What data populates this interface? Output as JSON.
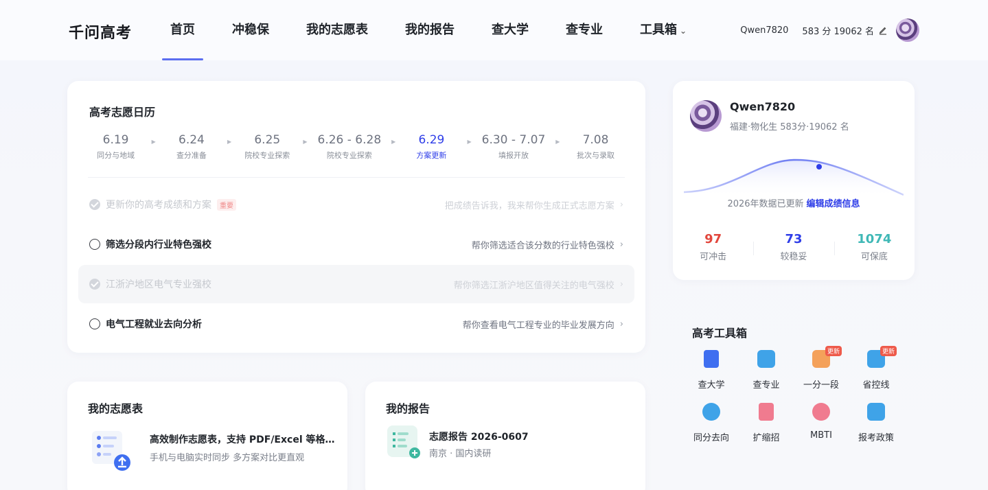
{
  "header": {
    "logo": "千问高考",
    "nav": [
      {
        "label": "首页",
        "active": true
      },
      {
        "label": "冲稳保"
      },
      {
        "label": "我的志愿表"
      },
      {
        "label": "我的报告"
      },
      {
        "label": "查大学"
      },
      {
        "label": "查专业"
      },
      {
        "label": "工具箱"
      }
    ],
    "username": "Qwen7820",
    "score_rank": "583 分 19062 名"
  },
  "calendar": {
    "title": "高考志愿日历",
    "steps": [
      {
        "date": "6.19",
        "label": "同分与地域"
      },
      {
        "date": "6.24",
        "label": "查分准备"
      },
      {
        "date": "6.25",
        "label": "院校专业探索"
      },
      {
        "date": "6.26 - 6.28",
        "label": "院校专业探索"
      },
      {
        "date": "6.29",
        "label": "方案更新",
        "active": true
      },
      {
        "date": "6.30 - 7.07",
        "label": "填报开放"
      },
      {
        "date": "7.08",
        "label": "批次与录取"
      }
    ],
    "tasks": [
      {
        "name": "更新你的高考成绩和方案",
        "badge": "重要",
        "desc": "把成绩告诉我，我来帮你生成正式志愿方案",
        "done": true
      },
      {
        "name": "筛选分段内行业特色强校",
        "desc": "帮你筛选适合该分数的行业特色强校",
        "done": false
      },
      {
        "name": "江浙沪地区电气专业强校",
        "desc": "帮你筛选江浙沪地区值得关注的电气强校",
        "done": true,
        "highlight": true
      },
      {
        "name": "电气工程就业去向分析",
        "desc": "帮你查看电气工程专业的毕业发展方向",
        "done": false
      }
    ]
  },
  "profile": {
    "name": "Qwen7820",
    "info": "福建·物化生 583分·19062 名",
    "update_text": "2026年数据已更新",
    "edit_link": "编辑成绩信息",
    "stats": [
      {
        "value": "97",
        "label": "可冲击",
        "color": "#e2463c"
      },
      {
        "value": "73",
        "label": "较稳妥",
        "color": "#2f3ee8"
      },
      {
        "value": "1074",
        "label": "可保底",
        "color": "#3fb8b6"
      }
    ]
  },
  "toolbox": {
    "title": "高考工具箱",
    "items": [
      {
        "label": "查大学",
        "color": "#3f6ff0",
        "icon": "university-icon"
      },
      {
        "label": "查专业",
        "color": "#3fa3e8",
        "icon": "major-icon"
      },
      {
        "label": "一分一段",
        "color": "#f4a15a",
        "icon": "score-segment-icon",
        "tag": "更新"
      },
      {
        "label": "省控线",
        "color": "#3fa3e8",
        "icon": "province-line-icon",
        "tag": "更新"
      },
      {
        "label": "同分去向",
        "color": "#3fa3e8",
        "icon": "same-score-icon"
      },
      {
        "label": "扩缩招",
        "color": "#f07b8f",
        "icon": "enrollment-change-icon"
      },
      {
        "label": "MBTI",
        "color": "#f07b8f",
        "icon": "mbti-icon"
      },
      {
        "label": "报考政策",
        "color": "#3fa3e8",
        "icon": "policy-icon"
      }
    ]
  },
  "wishlist": {
    "title": "我的志愿表",
    "item_title": "高效制作志愿表，支持 PDF/Excel 等格式导出",
    "item_sub": "手机与电脑实时同步 多方案对比更直观"
  },
  "report": {
    "title": "我的报告",
    "item_title": "志愿报告 2026-0607",
    "item_sub": "南京 · 国内读研"
  }
}
